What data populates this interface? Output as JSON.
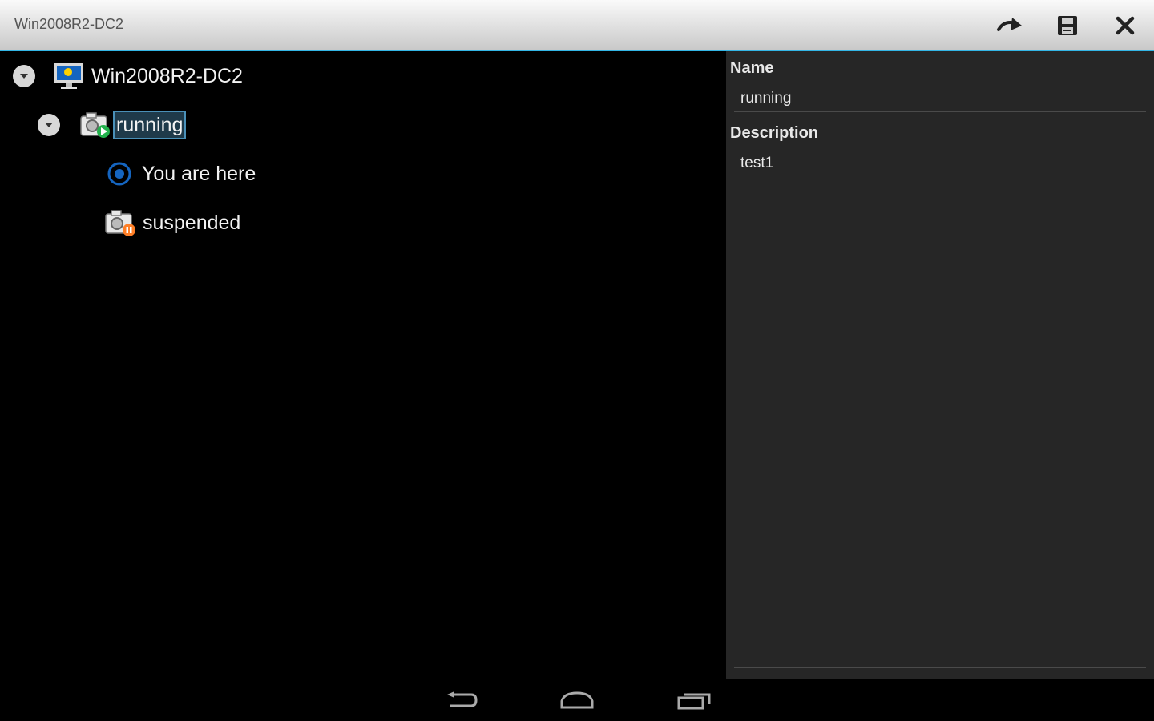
{
  "window": {
    "title": "Win2008R2-DC2",
    "toolbar": [
      {
        "name": "redo-arrow-icon"
      },
      {
        "name": "save-disk-icon"
      },
      {
        "name": "close-icon"
      }
    ]
  },
  "tree": {
    "root": {
      "label": "Win2008R2-DC2",
      "icon": "computer-monitor-icon",
      "expanded": true
    },
    "snapshot_running": {
      "label": "running",
      "icon": "snapshot-running-icon",
      "selected": true,
      "expanded": true
    },
    "current_state": {
      "label": "You are here",
      "icon": "you-are-here-icon"
    },
    "snapshot_suspended": {
      "label": "suspended",
      "icon": "snapshot-suspended-icon"
    }
  },
  "details": {
    "name_label": "Name",
    "name_value": "running",
    "description_label": "Description",
    "description_value": "test1"
  },
  "navbar": {
    "buttons": [
      {
        "name": "back-icon"
      },
      {
        "name": "home-icon"
      },
      {
        "name": "recent-apps-icon"
      }
    ]
  },
  "colors": {
    "accent": "#33b5e5",
    "running_badge": "#22b14c",
    "suspended_badge": "#ff7f27",
    "panel_bg": "#262626"
  }
}
